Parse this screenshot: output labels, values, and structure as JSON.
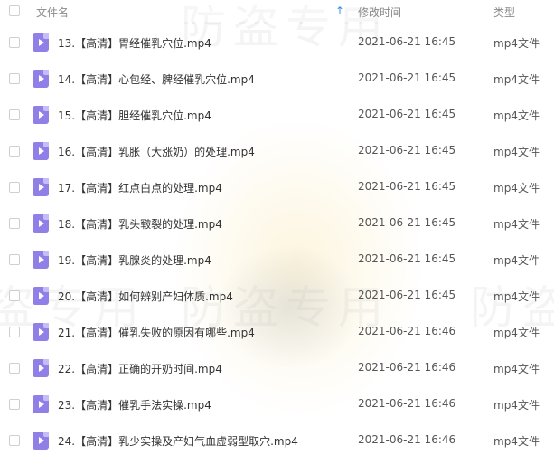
{
  "header": {
    "name_label": "文件名",
    "modified_label": "修改时间",
    "type_label": "类型",
    "sort_icon": "arrow-up-icon"
  },
  "watermark": "防盗专用",
  "colors": {
    "file_icon": "#8f7fe6",
    "sort_accent": "#3a8ee6"
  },
  "files": [
    {
      "name": "13.【高清】胃经催乳穴位.mp4",
      "modified": "2021-06-21 16:45",
      "type": "mp4文件"
    },
    {
      "name": "14.【高清】心包经、脾经催乳穴位.mp4",
      "modified": "2021-06-21 16:45",
      "type": "mp4文件"
    },
    {
      "name": "15.【高清】胆经催乳穴位.mp4",
      "modified": "2021-06-21 16:45",
      "type": "mp4文件"
    },
    {
      "name": "16.【高清】乳胀（大涨奶）的处理.mp4",
      "modified": "2021-06-21 16:45",
      "type": "mp4文件"
    },
    {
      "name": "17.【高清】红点白点的处理.mp4",
      "modified": "2021-06-21 16:45",
      "type": "mp4文件"
    },
    {
      "name": "18.【高清】乳头皲裂的处理.mp4",
      "modified": "2021-06-21 16:45",
      "type": "mp4文件"
    },
    {
      "name": "19.【高清】乳腺炎的处理.mp4",
      "modified": "2021-06-21 16:45",
      "type": "mp4文件"
    },
    {
      "name": "20.【高清】如何辨别产妇体质.mp4",
      "modified": "2021-06-21 16:45",
      "type": "mp4文件"
    },
    {
      "name": "21.【高清】催乳失败的原因有哪些.mp4",
      "modified": "2021-06-21 16:46",
      "type": "mp4文件"
    },
    {
      "name": "22.【高清】正确的开奶时间.mp4",
      "modified": "2021-06-21 16:46",
      "type": "mp4文件"
    },
    {
      "name": "23.【高清】催乳手法实操.mp4",
      "modified": "2021-06-21 16:46",
      "type": "mp4文件"
    },
    {
      "name": "24.【高清】乳少实操及产妇气血虚弱型取穴.mp4",
      "modified": "2021-06-21 16:46",
      "type": "mp4文件"
    }
  ]
}
